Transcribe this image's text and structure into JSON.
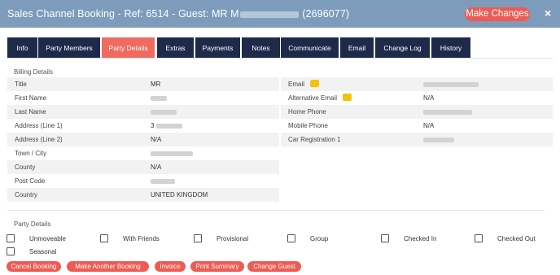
{
  "header": {
    "title_prefix": "Sales Channel Booking - Ref: 6514 - Guest: MR M",
    "title_suffix": "(2696077)",
    "make_changes_label": "Make Changes",
    "close_glyph": "×",
    "background": "#7d9cbc"
  },
  "tabs": [
    {
      "label": "Info"
    },
    {
      "label": "Party Members"
    },
    {
      "label": "Party Details",
      "active": true
    },
    {
      "label": "Extras"
    },
    {
      "label": "Payments"
    },
    {
      "label": "Notes"
    },
    {
      "label": "Communicate"
    },
    {
      "label": "Email"
    },
    {
      "label": "Change Log"
    },
    {
      "label": "History"
    }
  ],
  "billing": {
    "section_label": "Billing Details",
    "left_rows": [
      {
        "label": "Title",
        "value": "MR"
      },
      {
        "label": "First Name",
        "value": ""
      },
      {
        "label": "Last Name",
        "value": ""
      },
      {
        "label": "Address (Line 1)",
        "value": "3"
      },
      {
        "label": "Address (Line 2)",
        "value": "N/A"
      },
      {
        "label": "Town / City",
        "value": ""
      },
      {
        "label": "County",
        "value": "N/A"
      },
      {
        "label": "Post Code",
        "value": ""
      },
      {
        "label": "Country",
        "value": "UNITED KINGDOM"
      }
    ],
    "right_rows": [
      {
        "label": "Email",
        "value": "",
        "icon": "thumbs-up-icon"
      },
      {
        "label": "Alternative Email",
        "value": "N/A",
        "icon": "thumbs-up-icon"
      },
      {
        "label": "Home Phone",
        "value": ""
      },
      {
        "label": "Mobile Phone",
        "value": "N/A"
      },
      {
        "label": "Car Registration 1",
        "value": ""
      }
    ]
  },
  "party": {
    "section_label": "Party Details",
    "checkboxes": [
      {
        "label": "Unmoveable",
        "checked": false
      },
      {
        "label": "With Friends",
        "checked": false
      },
      {
        "label": "Provisional",
        "checked": false
      },
      {
        "label": "Group",
        "checked": false
      },
      {
        "label": "Checked In",
        "checked": false
      },
      {
        "label": "Checked Out",
        "checked": false
      },
      {
        "label": "Seasonal",
        "checked": false
      }
    ]
  },
  "actions": [
    {
      "label": "Cancel Booking"
    },
    {
      "label": "Make Another Booking"
    },
    {
      "label": "Invoice"
    },
    {
      "label": "Print Summary"
    },
    {
      "label": "Change Guest"
    }
  ],
  "colors": {
    "accent": "#ef5b52",
    "tab_dark": "#1e2a4a",
    "tab_active": "#ef6b5f",
    "icon_thumb": "#f4c20d"
  }
}
